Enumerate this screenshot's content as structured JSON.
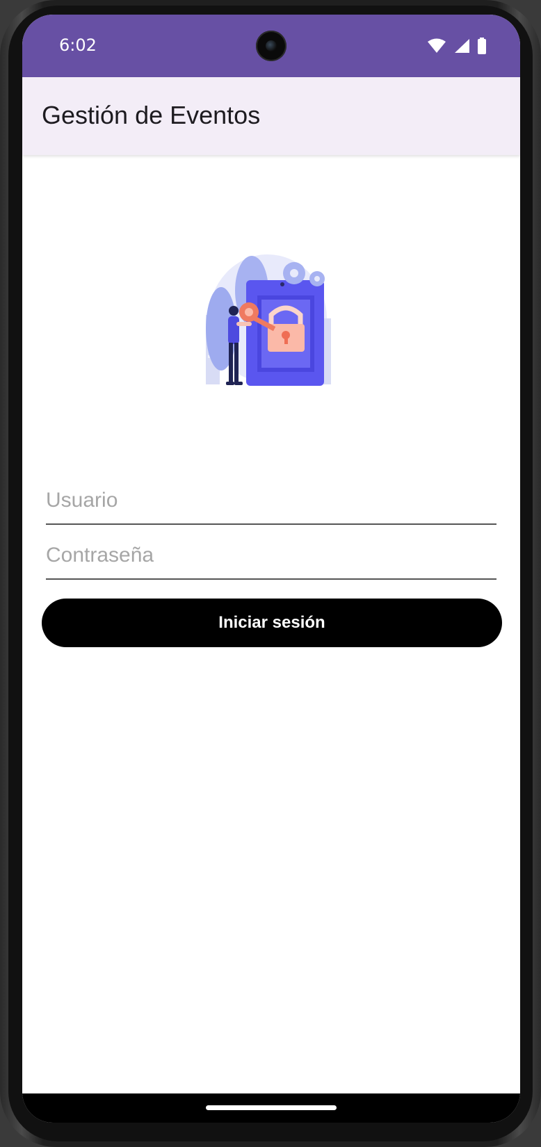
{
  "status_bar": {
    "time": "6:02",
    "icons": [
      "wifi-icon",
      "cellular-signal-icon",
      "battery-icon"
    ],
    "background_color": "#6750a4"
  },
  "app_bar": {
    "title": "Gestión de Eventos",
    "background_color": "#f3edf7"
  },
  "illustration": {
    "icon": "security-lock-key-illustration"
  },
  "login_form": {
    "username": {
      "value": "",
      "placeholder": "Usuario"
    },
    "password": {
      "value": "",
      "placeholder": "Contraseña"
    },
    "submit_label": "Iniciar sesión",
    "button_color": "#000000"
  },
  "nav_bar": {
    "icon": "home-gesture-handle"
  }
}
